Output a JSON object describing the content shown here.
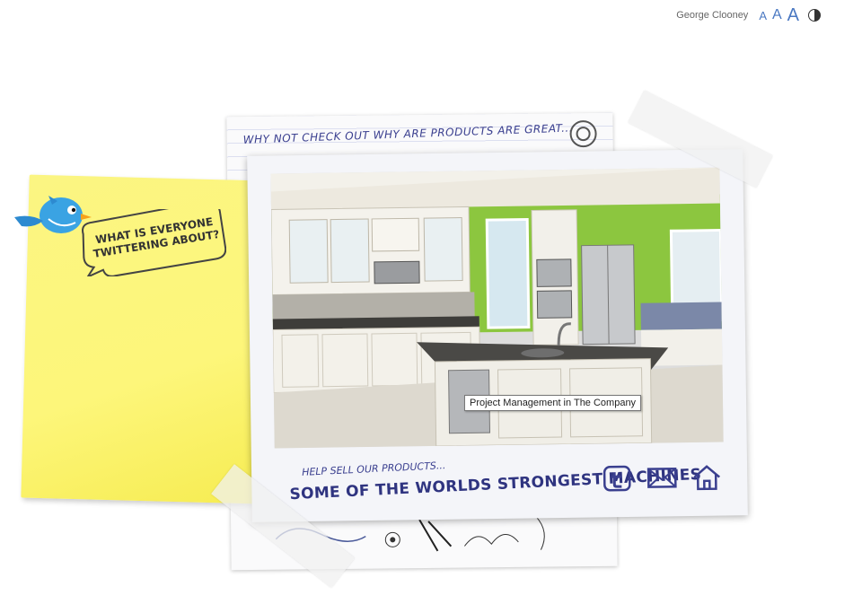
{
  "header": {
    "user_name": "George Clooney",
    "font_size_small": "A",
    "font_size_medium": "A",
    "font_size_large": "A"
  },
  "back_paper": {
    "title": "WHY NOT CHECK OUT WHY ARE PRODUCTS ARE GREAT..."
  },
  "sticky_note": {
    "bubble_text": "WHAT IS EVERYONE TWITTERING ABOUT?"
  },
  "polaroid": {
    "caption_small": "HELP SELL OUR PRODUCTS...",
    "caption_big": "SOME OF THE WORLDS STRONGEST MACHINES"
  },
  "tooltip": {
    "text": "Project Management in The Company"
  },
  "icons": [
    "twitter-icon",
    "mail-icon",
    "home-icon",
    "contrast-icon",
    "bird-icon",
    "spiral-icon"
  ],
  "colors": {
    "accent": "#4a78c2",
    "ink": "#2f3480",
    "sticky": "#fdf67a",
    "wall_green": "#8cc63f"
  }
}
